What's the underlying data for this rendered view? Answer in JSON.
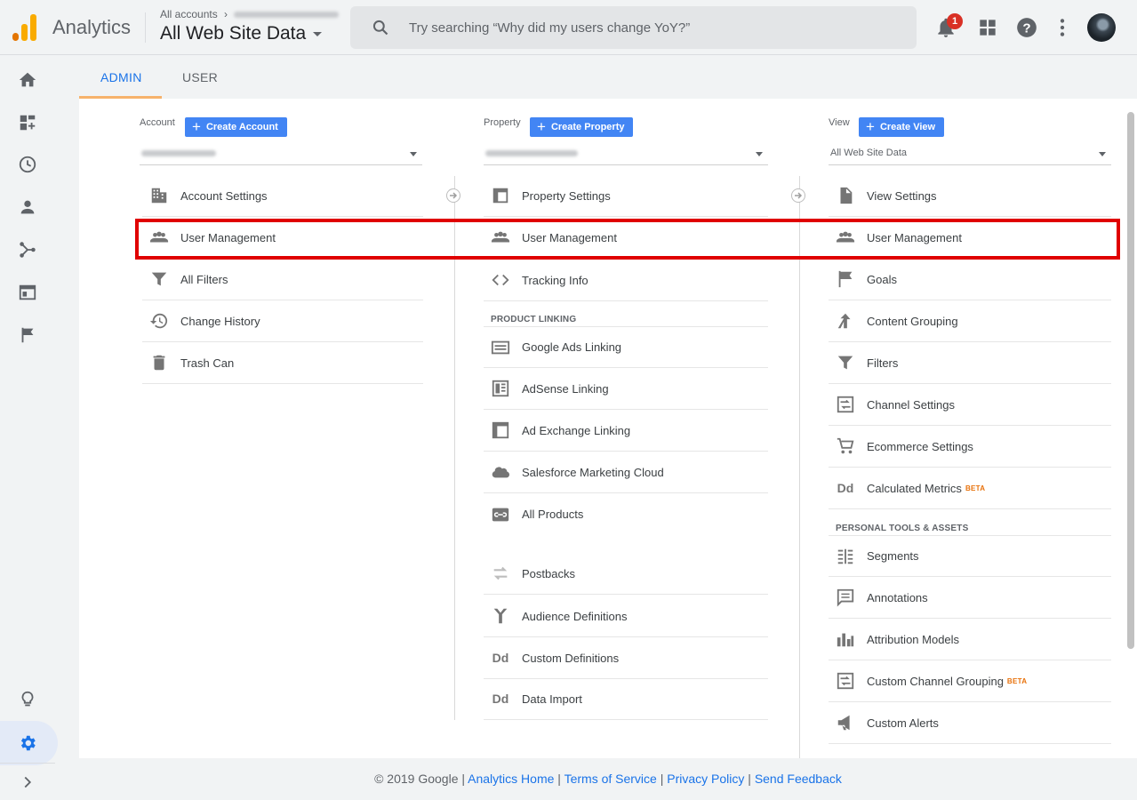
{
  "app": {
    "name": "Analytics"
  },
  "header": {
    "breadcrumb_root": "All accounts",
    "view_title": "All Web Site Data",
    "search_placeholder": "Try searching “Why did my users change YoY?”",
    "notification_count": "1"
  },
  "tabs": [
    {
      "label": "ADMIN",
      "active": true
    },
    {
      "label": "USER",
      "active": false
    }
  ],
  "account": {
    "label": "Account",
    "create_label": "Create Account",
    "items": [
      "Account Settings",
      "User Management",
      "All Filters",
      "Change History",
      "Trash Can"
    ]
  },
  "property": {
    "label": "Property",
    "create_label": "Create Property",
    "items": [
      "Property Settings",
      "User Management",
      "Tracking Info"
    ],
    "linking_header": "PRODUCT LINKING",
    "linking_items": [
      "Google Ads Linking",
      "AdSense Linking",
      "Ad Exchange Linking",
      "Salesforce Marketing Cloud",
      "All Products"
    ],
    "other_items": [
      "Postbacks",
      "Audience Definitions",
      "Custom Definitions",
      "Data Import"
    ]
  },
  "view": {
    "label": "View",
    "create_label": "Create View",
    "selected": "All Web Site Data",
    "items": [
      "View Settings",
      "User Management",
      "Goals",
      "Content Grouping",
      "Filters",
      "Channel Settings",
      "Ecommerce Settings",
      "Calculated Metrics"
    ],
    "tools_header": "PERSONAL TOOLS & ASSETS",
    "tools_items": [
      "Segments",
      "Annotations",
      "Attribution Models",
      "Custom Channel Grouping",
      "Custom Alerts"
    ],
    "beta_label": "BETA"
  },
  "footer": {
    "copyright": "© 2019 Google |",
    "links": [
      "Analytics Home",
      "Terms of Service",
      "Privacy Policy",
      "Send Feedback"
    ],
    "sep": "|"
  },
  "colors": {
    "accent": "#1a73e8",
    "button": "#4285f4",
    "highlight": "#e00000",
    "beta": "#e8710a",
    "logo_orange": "#f9ab00",
    "logo_dark": "#e37400"
  },
  "icons": [
    "search-icon",
    "bell-icon",
    "apps-icon",
    "help-icon",
    "more-icon",
    "home-icon",
    "customization-icon",
    "realtime-icon",
    "audience-icon",
    "acquisition-icon",
    "behavior-icon",
    "conversions-icon",
    "discover-icon",
    "admin-gear-icon",
    "expand-icon"
  ]
}
